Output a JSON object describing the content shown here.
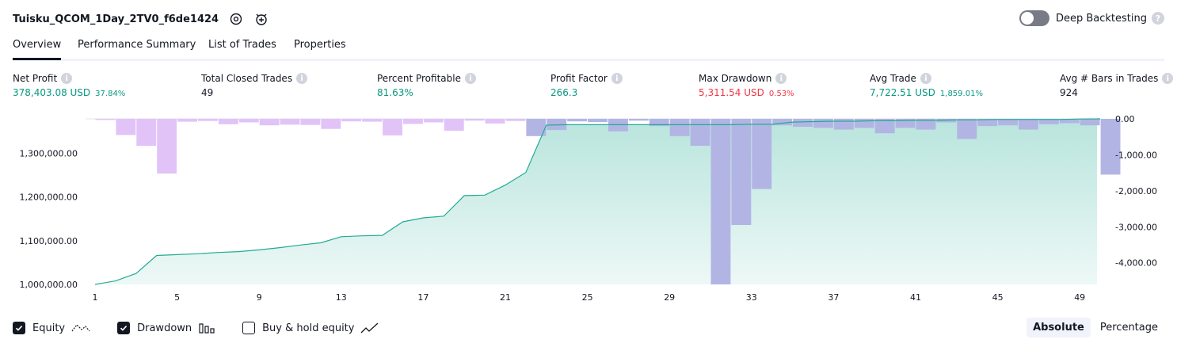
{
  "header": {
    "title": "Tuisku_QCOM_1Day_2TV0_f6de1424",
    "deep_backtesting_label": "Deep Backtesting",
    "deep_backtesting_enabled": false
  },
  "tabs": [
    {
      "label": "Overview",
      "active": true
    },
    {
      "label": "Performance Summary",
      "active": false
    },
    {
      "label": "List of Trades",
      "active": false
    },
    {
      "label": "Properties",
      "active": false
    }
  ],
  "metrics": [
    {
      "label": "Net Profit",
      "value": "378,403.08 USD",
      "sub": "37.84%",
      "color": "green"
    },
    {
      "label": "Total Closed Trades",
      "value": "49",
      "sub": "",
      "color": "dark"
    },
    {
      "label": "Percent Profitable",
      "value": "81.63%",
      "sub": "",
      "color": "green"
    },
    {
      "label": "Profit Factor",
      "value": "266.3",
      "sub": "",
      "color": "green"
    },
    {
      "label": "Max Drawdown",
      "value": "5,311.54 USD",
      "sub": "0.53%",
      "color": "red"
    },
    {
      "label": "Avg Trade",
      "value": "7,722.51 USD",
      "sub": "1,859.01%",
      "color": "green"
    },
    {
      "label": "Avg # Bars in Trades",
      "value": "924",
      "sub": "",
      "color": "dark"
    }
  ],
  "chart_data": {
    "type": "area",
    "x_ticks": [
      "1",
      "5",
      "9",
      "13",
      "17",
      "21",
      "25",
      "29",
      "33",
      "37",
      "41",
      "45",
      "49"
    ],
    "left_axis": {
      "ticks": [
        "1,300,000.00",
        "1,200,000.00",
        "1,100,000.00",
        "1,000,000.00"
      ],
      "ylim": [
        1000000,
        1378403.08
      ]
    },
    "right_axis": {
      "ticks": [
        "0.00",
        "-1,000.00",
        "-2,000.00",
        "-3,000.00",
        "-4,000.00"
      ],
      "ylim": [
        -4600,
        0
      ]
    },
    "series": [
      {
        "name": "Equity",
        "color": "#22ab94",
        "x": [
          1,
          2,
          3,
          4,
          5,
          6,
          7,
          8,
          9,
          10,
          11,
          12,
          13,
          14,
          15,
          16,
          17,
          18,
          19,
          20,
          21,
          22,
          23,
          24,
          25,
          26,
          27,
          28,
          29,
          30,
          31,
          32,
          33,
          34,
          35,
          36,
          37,
          38,
          39,
          40,
          41,
          42,
          43,
          44,
          45,
          46,
          47,
          48,
          49,
          50
        ],
        "values": [
          1000000,
          1008000,
          1025000,
          1066000,
          1068000,
          1070000,
          1073000,
          1075000,
          1079000,
          1084000,
          1090000,
          1095000,
          1109000,
          1111000,
          1112000,
          1143000,
          1152000,
          1156000,
          1203000,
          1204000,
          1227000,
          1256000,
          1364000,
          1365000,
          1365000,
          1365000,
          1365000,
          1365000,
          1365000,
          1365000,
          1365000,
          1365000,
          1366000,
          1366000,
          1371000,
          1372000,
          1373000,
          1373000,
          1374000,
          1374000,
          1375000,
          1375000,
          1376000,
          1376000,
          1377000,
          1377000,
          1377000,
          1377000,
          1378000,
          1378403
        ]
      },
      {
        "name": "Drawdown",
        "color_before": "#e1c3f8",
        "color_after": "#b2b5e4",
        "x": [
          1,
          2,
          3,
          4,
          5,
          6,
          7,
          8,
          9,
          10,
          11,
          12,
          13,
          14,
          15,
          16,
          17,
          18,
          19,
          20,
          21,
          22,
          23,
          24,
          25,
          26,
          27,
          28,
          29,
          30,
          31,
          32,
          33,
          34,
          35,
          36,
          37,
          38,
          39,
          40,
          41,
          42,
          43,
          44,
          45,
          46,
          47,
          48,
          49,
          50
        ],
        "values": [
          -30,
          -450,
          -750,
          -1520,
          -80,
          -60,
          -150,
          -100,
          -180,
          -160,
          -170,
          -280,
          -70,
          -80,
          -460,
          -140,
          -100,
          -330,
          -50,
          -130,
          -60,
          -480,
          -310,
          -70,
          -90,
          -350,
          -50,
          -200,
          -480,
          -750,
          -4600,
          -2950,
          -1950,
          -180,
          -220,
          -250,
          -300,
          -250,
          -400,
          -250,
          -300,
          -100,
          -560,
          -200,
          -180,
          -300,
          -150,
          -120,
          -180,
          -1550
        ]
      }
    ]
  },
  "legend": [
    {
      "label": "Equity",
      "checked": true,
      "icon": "equity-line-icon"
    },
    {
      "label": "Drawdown",
      "checked": true,
      "icon": "drawdown-bars-icon"
    },
    {
      "label": "Buy & hold equity",
      "checked": false,
      "icon": "buy-hold-line-icon"
    }
  ],
  "mode": {
    "options": [
      "Absolute",
      "Percentage"
    ],
    "selected": "Absolute"
  }
}
